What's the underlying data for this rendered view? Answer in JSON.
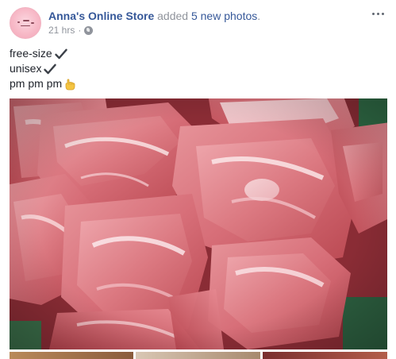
{
  "post": {
    "author": "Anna's Online Store",
    "action_text": " added ",
    "action_link": "5 new photos",
    "action_end": ".",
    "time": "21 hrs",
    "separator": "·",
    "privacy_icon": "globe-icon",
    "more_icon": "ellipsis-icon",
    "lines": [
      {
        "text": "free-size",
        "icon": "check-icon"
      },
      {
        "text": "unisex",
        "icon": "check-icon"
      },
      {
        "text": "pm pm pm",
        "icon": "pointing-hand-icon"
      }
    ],
    "photos": {
      "count": 5,
      "main_subject": "raw-pork-cuts-photo"
    }
  },
  "colors": {
    "link": "#365899",
    "meta": "#90949c",
    "text": "#1d2129",
    "avatar": "#f7b9c7"
  }
}
